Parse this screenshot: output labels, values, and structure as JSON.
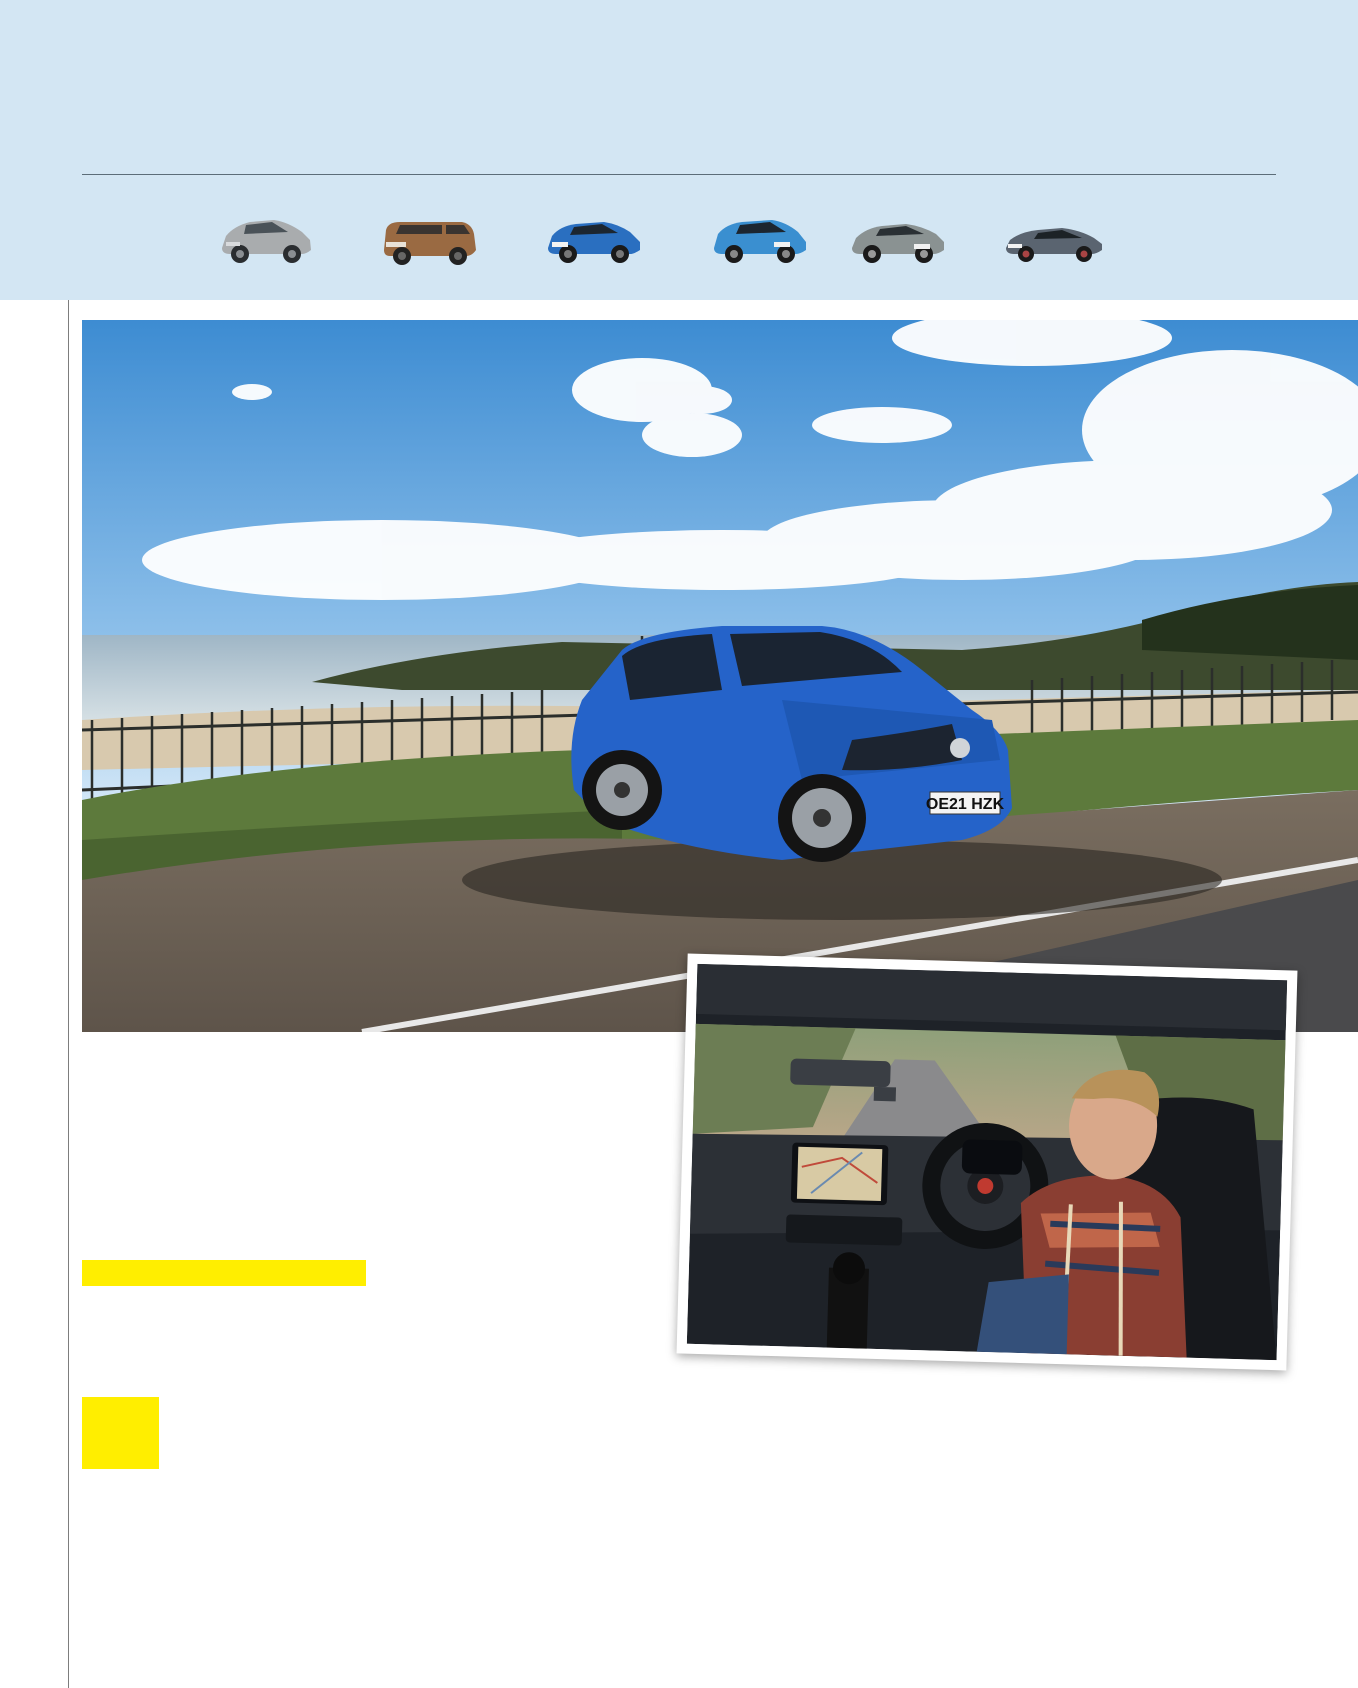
{
  "header": {
    "background_color": "#d3e6f3",
    "thumbnails": [
      {
        "icon": "silver-suv-icon",
        "body_color": "#a9acae"
      },
      {
        "icon": "bronze-4x4-icon",
        "body_color": "#9a6a42"
      },
      {
        "icon": "blue-crossover-icon",
        "body_color": "#2a6fc0"
      },
      {
        "icon": "blue-suv-icon",
        "body_color": "#3a8fd0"
      },
      {
        "icon": "grey-fastback-icon",
        "body_color": "#8a9292"
      },
      {
        "icon": "grey-saloon-icon",
        "body_color": "#5a6470"
      }
    ]
  },
  "hero": {
    "number_plate": "OE21 HZK",
    "car_color": "#2563c9"
  },
  "inset": {
    "sat_nav_icon": "map-screen-icon"
  },
  "accents": {
    "yellow": "#ffee00"
  }
}
